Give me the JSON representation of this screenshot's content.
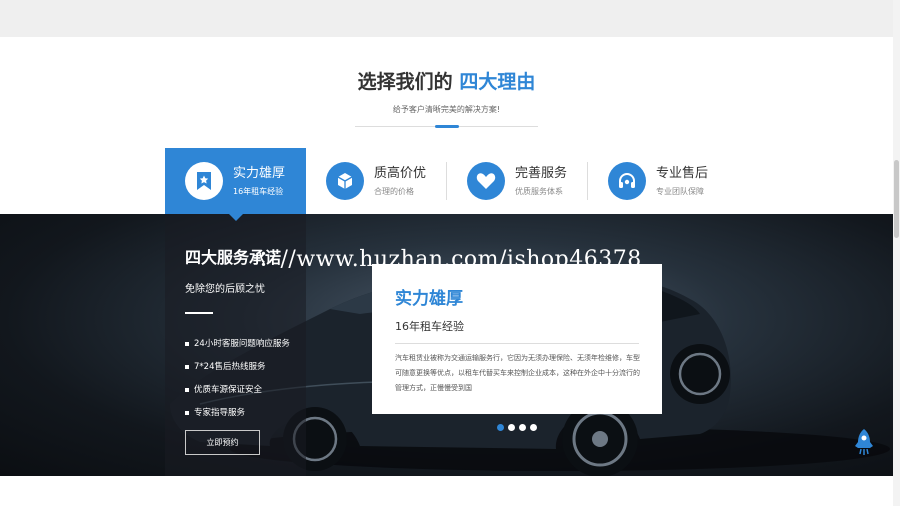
{
  "section": {
    "title_prefix": "选择我们的",
    "title_highlight": "四大理由",
    "subtitle": "给予客户清晰完美的解决方案!"
  },
  "tabs": [
    {
      "title": "实力雄厚",
      "sub": "16年租车经验",
      "icon": "bookmark-star-icon",
      "active": true
    },
    {
      "title": "质高价优",
      "sub": "合理的价格",
      "icon": "cube-icon",
      "active": false
    },
    {
      "title": "完善服务",
      "sub": "优质服务体系",
      "icon": "heart-icon",
      "active": false
    },
    {
      "title": "专业售后",
      "sub": "专业团队保障",
      "icon": "headset-icon",
      "active": false
    }
  ],
  "banner": {
    "panel_title": "四大服务承诺",
    "panel_sub": "免除您的后顾之忧",
    "list": [
      "24小时客服问题响应服务",
      "7*24售后热线服务",
      "优质车源保证安全",
      "专家指导服务"
    ],
    "cta": "立即预约"
  },
  "watermark": "：//www.huzhan.com/ishop46378",
  "card": {
    "title": "实力雄厚",
    "sub": "16年租车经验",
    "body": "汽车租赁业被称为交通运输服务行，它因为无须办理保险、无须年检维修，车型可随意更换等优点，以租车代替买车来控制企业成本，这种在外企中十分流行的管理方式，正慢慢受到国"
  },
  "carousel": {
    "count": 4,
    "active_index": 0
  },
  "colors": {
    "accent": "#2f86d6",
    "dark": "#12171d"
  }
}
